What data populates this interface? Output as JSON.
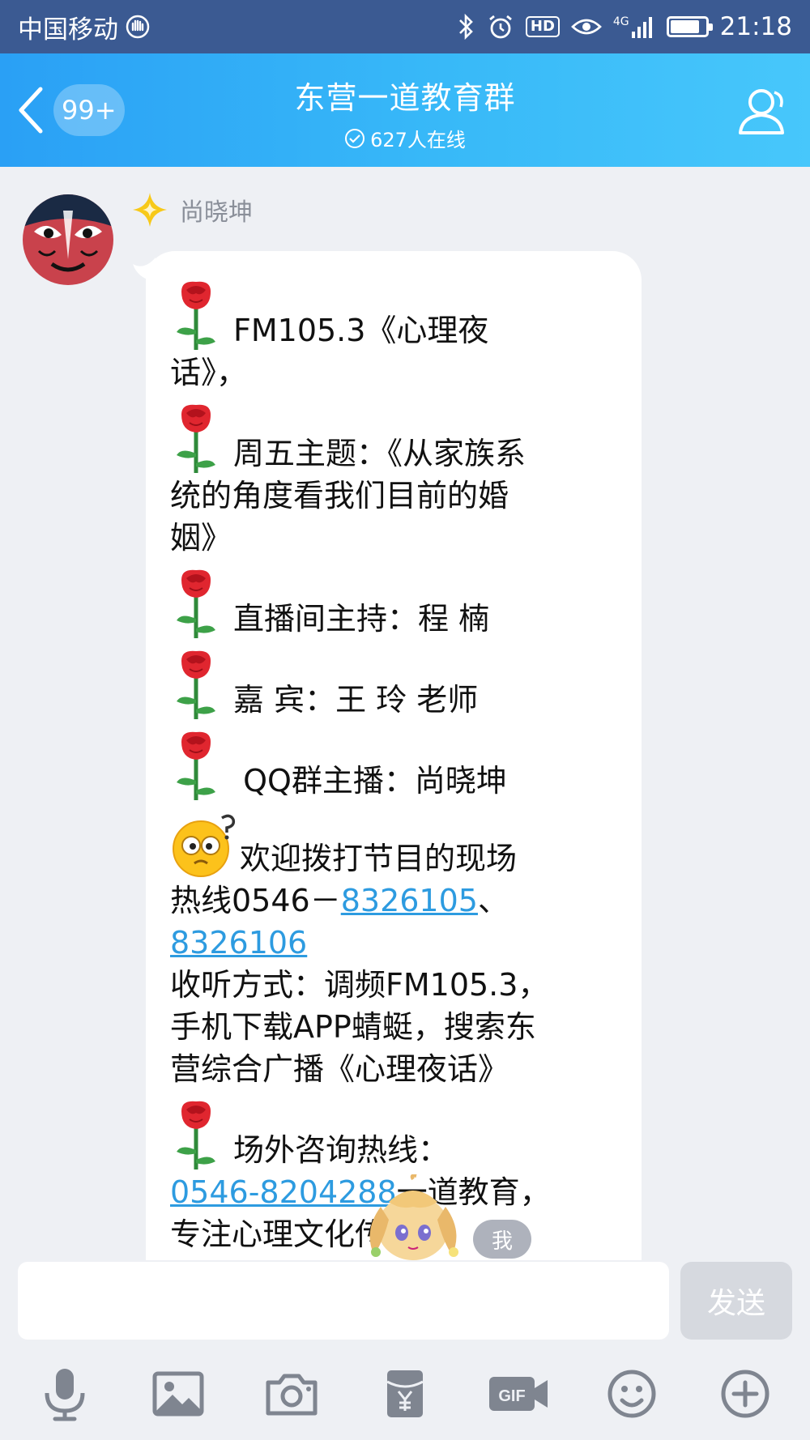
{
  "status_bar": {
    "carrier": "中国移动",
    "signal_label": "4G",
    "hd_label": "HD",
    "time": "21:18",
    "battery_level_percent": 80
  },
  "header": {
    "back_badge": "99+",
    "title": "东营一道教育群",
    "online_text": "627人在线"
  },
  "message": {
    "sender": "尚晓坤",
    "blocks": [
      {
        "icon": "rose",
        "lines": [
          "FM105.3《心理夜",
          "话》，"
        ]
      },
      {
        "icon": "rose",
        "lines": [
          "周五主题：《从家族系",
          "统的角度看我们目前的婚",
          "姻》"
        ]
      },
      {
        "icon": "rose",
        "lines": [
          "直播间主持：程  楠"
        ]
      },
      {
        "icon": "rose",
        "lines": [
          "嘉      宾：王   玲 老师"
        ]
      },
      {
        "icon": "rose",
        "lines": [
          " QQ群主播：尚晓坤"
        ]
      }
    ],
    "hotline": {
      "intro": "欢迎拨打节目的现场",
      "prefix": "热线0546－",
      "phone1": "8326105",
      "separator": "、",
      "phone2": "8326106"
    },
    "listen_lines": [
      "收听方式：调频FM105.3，",
      "手机下载APP蜻蜓，搜索东",
      "营综合广播《心理夜话》"
    ],
    "consult": {
      "title": "场外咨询热线：",
      "phone": "0546-8204288",
      "suffix": "一道教育，",
      "last_line": "专注心理文化传播"
    }
  },
  "pet_tag": "我",
  "input": {
    "value": "",
    "placeholder": "",
    "send_label": "发送"
  },
  "toolbar": [
    "microphone-icon",
    "image-icon",
    "camera-icon",
    "red-packet-icon",
    "gif-icon",
    "emoji-icon",
    "plus-icon"
  ],
  "colors": {
    "status_bar": "#3b5a92",
    "header_start": "#2aa0f5",
    "header_end": "#47c7fb",
    "link": "#2d9be0",
    "background": "#eef0f4"
  }
}
